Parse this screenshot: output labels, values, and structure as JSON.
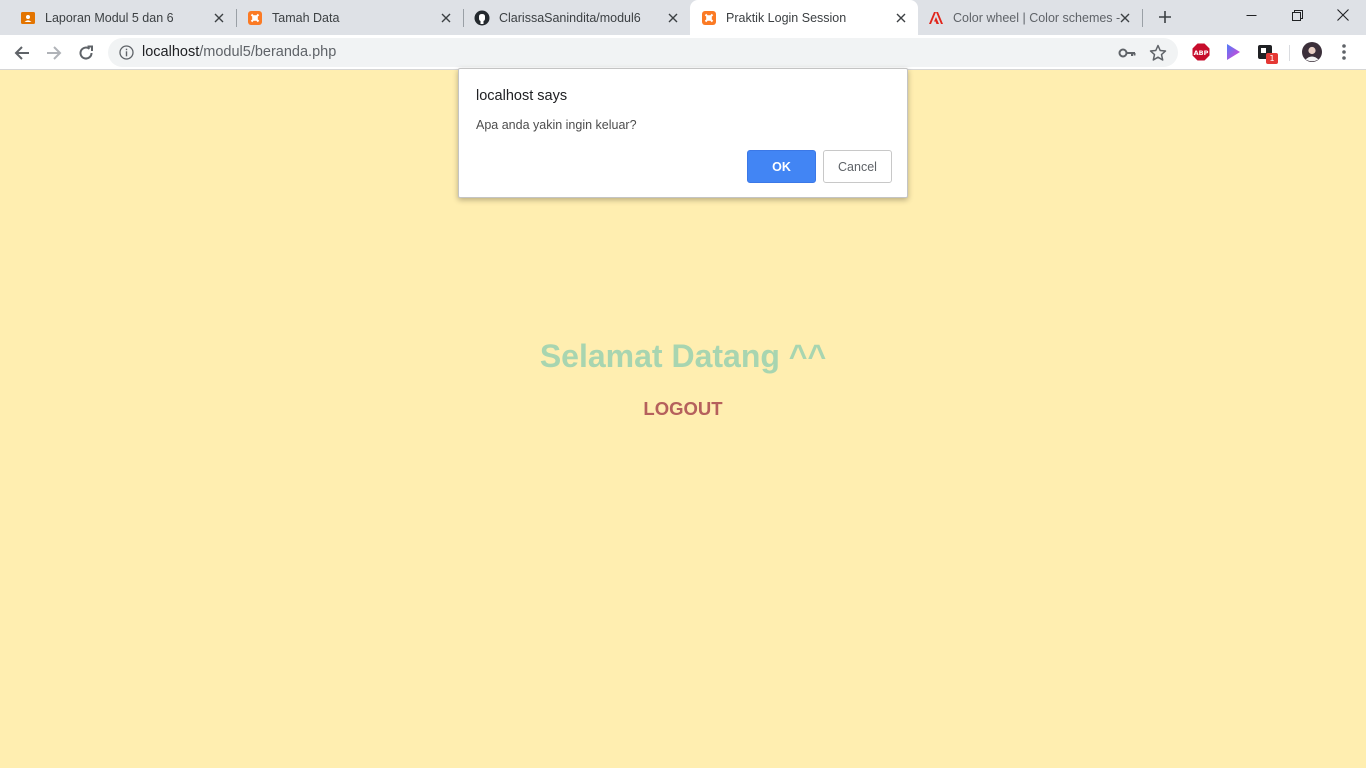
{
  "browser": {
    "tabs": [
      {
        "title": "Laporan Modul 5 dan 6",
        "icon": "slides-icon",
        "active": false
      },
      {
        "title": "Tamah Data",
        "icon": "xampp-icon",
        "active": false
      },
      {
        "title": "ClarissaSanindita/modul6",
        "icon": "github-icon",
        "active": false
      },
      {
        "title": "Praktik Login Session",
        "icon": "xampp-icon",
        "active": true
      },
      {
        "title": "Color wheel | Color schemes -",
        "icon": "adobe-icon",
        "active": false
      }
    ],
    "url_host": "localhost",
    "url_path": "/modul5/beranda.php",
    "extension_badge": "1",
    "abp_label": "ABP"
  },
  "page": {
    "welcome": "Selamat Datang ^^",
    "logout": "LOGOUT"
  },
  "dialog": {
    "title": "localhost says",
    "message": "Apa anda yakin ingin keluar?",
    "ok_label": "OK",
    "cancel_label": "Cancel"
  },
  "colors": {
    "page_background": "#ffeeb0",
    "welcome_text": "#a8d5b0",
    "logout_text": "#b5605c",
    "ok_button": "#4285f4"
  }
}
